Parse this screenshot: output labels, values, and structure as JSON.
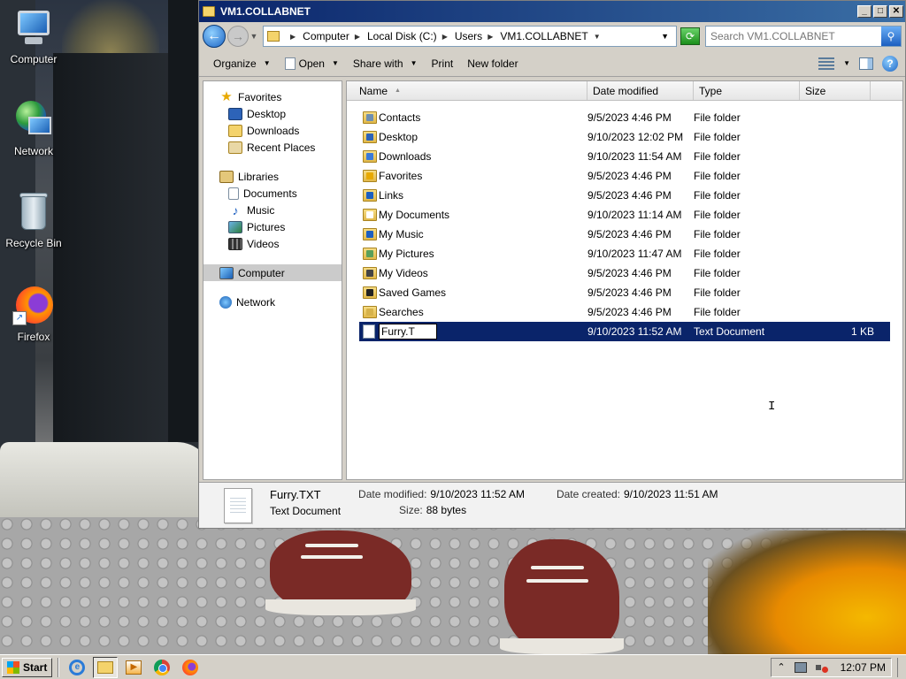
{
  "desktop": {
    "icons": [
      {
        "label": "Computer",
        "icon": "computer-icon"
      },
      {
        "label": "Network",
        "icon": "network-icon"
      },
      {
        "label": "Recycle Bin",
        "icon": "recycle-bin-icon"
      },
      {
        "label": "Firefox",
        "icon": "firefox-icon"
      }
    ]
  },
  "window": {
    "title": "VM1.COLLABNET",
    "buttons": {
      "minimize": "_",
      "maximize": "□",
      "close": "✕"
    }
  },
  "address": {
    "crumbs": [
      "Computer",
      "Local Disk (C:)",
      "Users",
      "VM1.COLLABNET"
    ],
    "search_placeholder": "Search VM1.COLLABNET"
  },
  "toolbar": {
    "organize": "Organize",
    "open": "Open",
    "share_with": "Share with",
    "print": "Print",
    "new_folder": "New folder"
  },
  "navpane": {
    "favorites": {
      "label": "Favorites",
      "items": [
        "Desktop",
        "Downloads",
        "Recent Places"
      ]
    },
    "libraries": {
      "label": "Libraries",
      "items": [
        "Documents",
        "Music",
        "Pictures",
        "Videos"
      ]
    },
    "computer": "Computer",
    "network": "Network"
  },
  "columns": {
    "name": "Name",
    "date": "Date modified",
    "type": "Type",
    "size": "Size"
  },
  "files": [
    {
      "name": "Contacts",
      "date": "9/5/2023 4:46 PM",
      "type": "File folder",
      "size": "",
      "badge": "#6f8fb0"
    },
    {
      "name": "Desktop",
      "date": "9/10/2023 12:02 PM",
      "type": "File folder",
      "size": "",
      "badge": "#2d63b8"
    },
    {
      "name": "Downloads",
      "date": "9/10/2023 11:54 AM",
      "type": "File folder",
      "size": "",
      "badge": "#3b7ad8"
    },
    {
      "name": "Favorites",
      "date": "9/5/2023 4:46 PM",
      "type": "File folder",
      "size": "",
      "badge": "#e8a900"
    },
    {
      "name": "Links",
      "date": "9/5/2023 4:46 PM",
      "type": "File folder",
      "size": "",
      "badge": "#1c5fc0"
    },
    {
      "name": "My Documents",
      "date": "9/10/2023 11:14 AM",
      "type": "File folder",
      "size": "",
      "badge": "#ffffff"
    },
    {
      "name": "My Music",
      "date": "9/5/2023 4:46 PM",
      "type": "File folder",
      "size": "",
      "badge": "#1c5fc0"
    },
    {
      "name": "My Pictures",
      "date": "9/10/2023 11:47 AM",
      "type": "File folder",
      "size": "",
      "badge": "#5aa05a"
    },
    {
      "name": "My Videos",
      "date": "9/5/2023 4:46 PM",
      "type": "File folder",
      "size": "",
      "badge": "#444444"
    },
    {
      "name": "Saved Games",
      "date": "9/5/2023 4:46 PM",
      "type": "File folder",
      "size": "",
      "badge": "#222222"
    },
    {
      "name": "Searches",
      "date": "9/5/2023 4:46 PM",
      "type": "File folder",
      "size": "",
      "badge": "#d6b24a"
    }
  ],
  "selected_file": {
    "rename_value": "Furry.T",
    "date": "9/10/2023 11:52 AM",
    "type": "Text Document",
    "size": "1 KB"
  },
  "details": {
    "name": "Furry.TXT",
    "type": "Text Document",
    "modified_label": "Date modified:",
    "modified": "9/10/2023 11:52 AM",
    "size_label": "Size:",
    "size": "88 bytes",
    "created_label": "Date created:",
    "created": "9/10/2023 11:51 AM"
  },
  "taskbar": {
    "start": "Start",
    "clock": "12:07 PM"
  },
  "colors": {
    "selection": "#0a246a",
    "titlebar": "#0a246a",
    "window_face": "#d4d0c8"
  }
}
